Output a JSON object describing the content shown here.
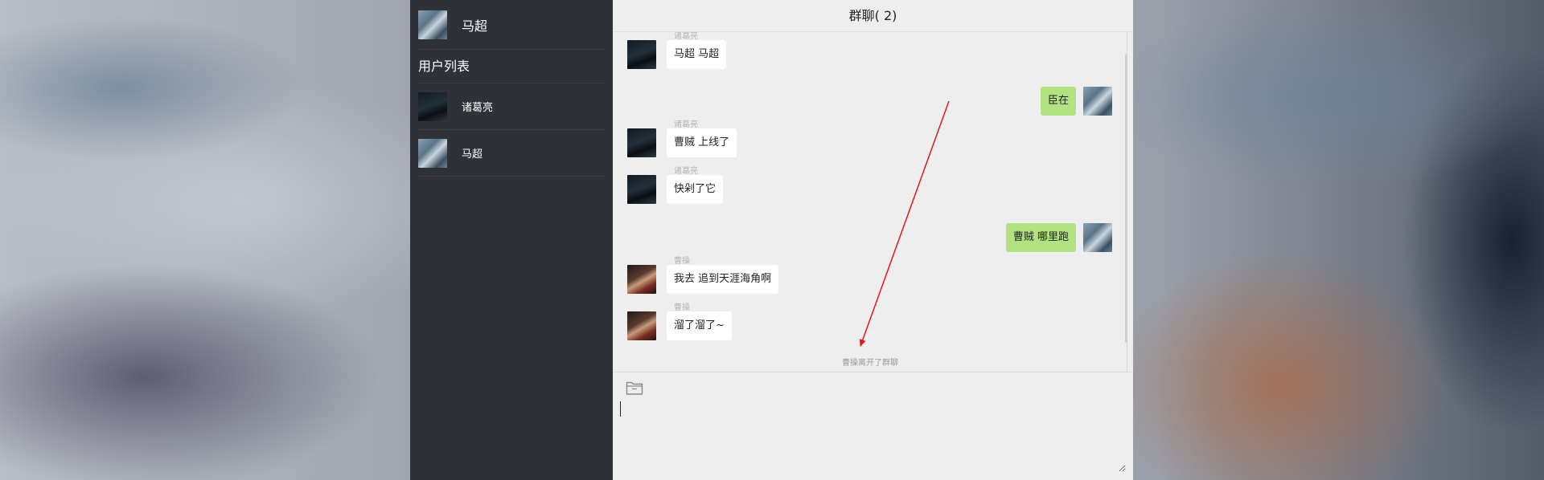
{
  "current_user": {
    "name": "马超",
    "avatar": "ma-chao-avatar"
  },
  "sidebar": {
    "list_title": "用户列表",
    "users": [
      {
        "name": "诸葛亮",
        "avatar": "zhuge-liang-avatar"
      },
      {
        "name": "马超",
        "avatar": "ma-chao-avatar"
      }
    ]
  },
  "chat": {
    "title": "群聊( 2)",
    "messages": [
      {
        "side": "left",
        "nick": "诸葛亮",
        "text": "马超 马超"
      },
      {
        "side": "right",
        "nick": "",
        "text": "臣在"
      },
      {
        "side": "left",
        "nick": "诸葛亮",
        "text": "曹贼 上线了"
      },
      {
        "side": "left",
        "nick": "诸葛亮",
        "text": "快剁了它"
      },
      {
        "side": "right",
        "nick": "",
        "text": "曹贼 哪里跑"
      },
      {
        "side": "left",
        "nick": "曹操",
        "text": "我去 追到天涯海角啊"
      },
      {
        "side": "left",
        "nick": "曹操",
        "text": "溜了溜了~"
      }
    ],
    "system_notice": "曹操离开了群聊"
  },
  "composer": {
    "value": "",
    "placeholder": ""
  },
  "colors": {
    "sidebar_bg": "#2e3138",
    "chat_bg": "#eeeeee",
    "self_bubble": "#b2e281",
    "other_bubble": "#ffffff",
    "annotation_arrow": "#e01818"
  }
}
